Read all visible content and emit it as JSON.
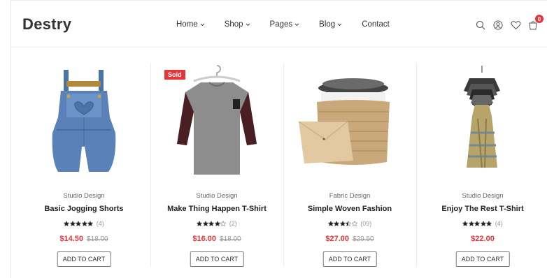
{
  "brand": {
    "name": "Destry"
  },
  "nav": {
    "items": [
      {
        "label": "Home",
        "has_dropdown": true
      },
      {
        "label": "Shop",
        "has_dropdown": true
      },
      {
        "label": "Pages",
        "has_dropdown": true
      },
      {
        "label": "Blog",
        "has_dropdown": true
      },
      {
        "label": "Contact",
        "has_dropdown": false
      }
    ]
  },
  "header_icons": {
    "search": "search-icon",
    "account": "user-icon",
    "wishlist": "heart-icon",
    "cart": "cart-icon",
    "cart_count": "0"
  },
  "colors": {
    "accent": "#e8333a",
    "text": "#222222",
    "muted": "#999999"
  },
  "products": [
    {
      "brand": "Studio Design",
      "title": "Basic Jogging Shorts",
      "stars": 5,
      "reviews": "(4)",
      "price": "$14.50",
      "old_price": "$18.00",
      "badge": "",
      "button": "ADD TO CART"
    },
    {
      "brand": "Studio Design",
      "title": "Make Thing Happen T-Shirt",
      "stars": 4,
      "reviews": "(2)",
      "price": "$16.00",
      "old_price": "$18.00",
      "badge": "Sold",
      "button": "ADD TO CART"
    },
    {
      "brand": "Fabric Design",
      "title": "Simple Woven Fashion",
      "stars": 3.5,
      "reviews": "(09)",
      "price": "$27.00",
      "old_price": "$29.50",
      "badge": "",
      "button": "ADD TO CART"
    },
    {
      "brand": "Studio Design",
      "title": "Enjoy The Rest T-Shirt",
      "stars": 5,
      "reviews": "(4)",
      "price": "$22.00",
      "old_price": "",
      "badge": "",
      "button": "ADD TO CART"
    }
  ]
}
